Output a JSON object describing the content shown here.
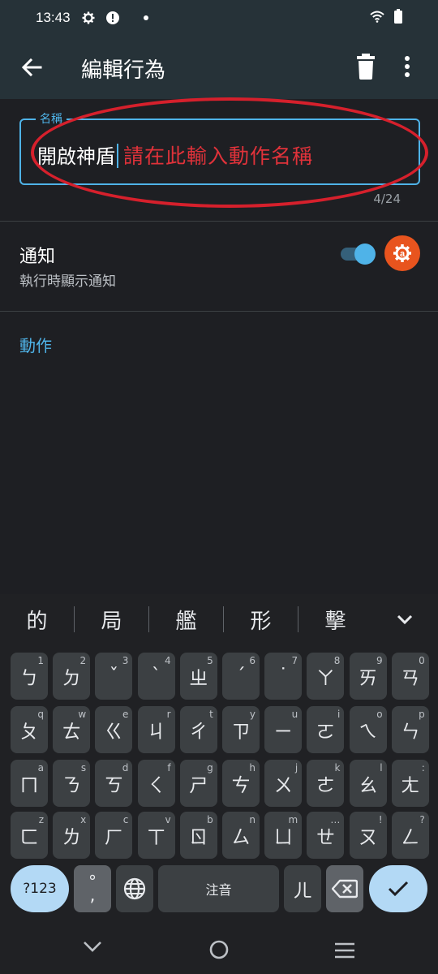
{
  "status_bar": {
    "time": "13:43",
    "icons": [
      "settings-icon",
      "alert-icon",
      "dot-icon",
      "wifi-icon",
      "battery-icon"
    ]
  },
  "app_bar": {
    "title": "編輯行為",
    "back_icon": "arrow-back-icon",
    "delete_icon": "trash-icon",
    "menu_icon": "more-vert-icon"
  },
  "name_field": {
    "label": "名稱",
    "value": "開啟神盾",
    "annotation": "請在此輸入動作名稱",
    "counter": "4/24"
  },
  "notification": {
    "title": "通知",
    "subtitle": "執行時顯示通知",
    "enabled": true,
    "app_badge_icon": "automate-icon"
  },
  "actions": {
    "label": "動作"
  },
  "keyboard": {
    "suggestions": [
      "的",
      "局",
      "艦",
      "形",
      "擊"
    ],
    "rows": [
      [
        {
          "k": "ㄅ",
          "s": "1"
        },
        {
          "k": "ㄉ",
          "s": "2"
        },
        {
          "k": "ˇ",
          "s": "3"
        },
        {
          "k": "ˋ",
          "s": "4"
        },
        {
          "k": "ㄓ",
          "s": "5"
        },
        {
          "k": "ˊ",
          "s": "6"
        },
        {
          "k": "˙",
          "s": "7"
        },
        {
          "k": "ㄚ",
          "s": "8"
        },
        {
          "k": "ㄞ",
          "s": "9"
        },
        {
          "k": "ㄢ",
          "s": "0"
        }
      ],
      [
        {
          "k": "ㄆ",
          "s": "q"
        },
        {
          "k": "ㄊ",
          "s": "w"
        },
        {
          "k": "ㄍ",
          "s": "e"
        },
        {
          "k": "ㄐ",
          "s": "r"
        },
        {
          "k": "ㄔ",
          "s": "t"
        },
        {
          "k": "ㄗ",
          "s": "y"
        },
        {
          "k": "ㄧ",
          "s": "u"
        },
        {
          "k": "ㄛ",
          "s": "i"
        },
        {
          "k": "ㄟ",
          "s": "o"
        },
        {
          "k": "ㄣ",
          "s": "p"
        }
      ],
      [
        {
          "k": "ㄇ",
          "s": "a"
        },
        {
          "k": "ㄋ",
          "s": "s"
        },
        {
          "k": "ㄎ",
          "s": "d"
        },
        {
          "k": "ㄑ",
          "s": "f"
        },
        {
          "k": "ㄕ",
          "s": "g"
        },
        {
          "k": "ㄘ",
          "s": "h"
        },
        {
          "k": "ㄨ",
          "s": "j"
        },
        {
          "k": "ㄜ",
          "s": "k"
        },
        {
          "k": "ㄠ",
          "s": "l"
        },
        {
          "k": "ㄤ",
          "s": ":"
        }
      ],
      [
        {
          "k": "ㄈ",
          "s": "z"
        },
        {
          "k": "ㄌ",
          "s": "x"
        },
        {
          "k": "ㄏ",
          "s": "c"
        },
        {
          "k": "ㄒ",
          "s": "v"
        },
        {
          "k": "ㄖ",
          "s": "b"
        },
        {
          "k": "ㄙ",
          "s": "n"
        },
        {
          "k": "ㄩ",
          "s": "m"
        },
        {
          "k": "ㄝ",
          "s": "…"
        },
        {
          "k": "ㄡ",
          "s": "!"
        },
        {
          "k": "ㄥ",
          "s": "?"
        }
      ]
    ],
    "bottom": {
      "symbols_label": "?123",
      "punct_top": "°",
      "punct_bottom": ",",
      "space_label": "注音",
      "er_label": "ㄦ",
      "globe_icon": "globe-icon",
      "backspace_icon": "backspace-icon",
      "enter_icon": "check-icon"
    }
  },
  "nav_bar": {
    "icons": [
      "chevron-down-icon",
      "home-circle-icon",
      "menu-lines-icon"
    ]
  },
  "colors": {
    "accent": "#4fb3e8",
    "annotation_red": "#d6202c",
    "appbar": "#263238",
    "badge": "#e8541e"
  }
}
